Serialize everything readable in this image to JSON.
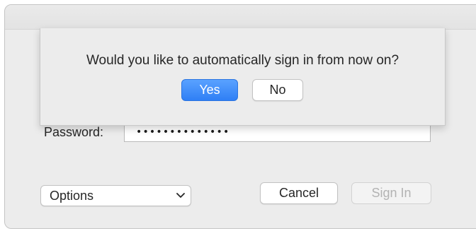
{
  "dialog": {
    "password_label": "Password:",
    "password_value": "••••••••••••••",
    "options_label": "Options",
    "cancel_label": "Cancel",
    "sign_in_label": "Sign In"
  },
  "sheet": {
    "message": "Would you like to automatically sign in from now on?",
    "yes_label": "Yes",
    "no_label": "No"
  },
  "icons": {
    "options_chevron": "chevron-down-icon"
  },
  "colors": {
    "accent": "#2f7ff5",
    "window_bg": "#ececec",
    "disabled_text": "#b3b3b3"
  }
}
